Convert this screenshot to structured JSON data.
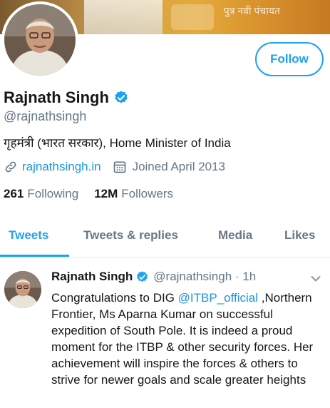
{
  "banner": {
    "text": "पुत्र नवी पंचायत"
  },
  "profile": {
    "name": "Rajnath Singh",
    "handle": "@rajnathsingh",
    "bio": "गृहमंत्री (भारत सरकार), Home Minister of India",
    "website": "rajnathsingh.in",
    "joined": "Joined April 2013",
    "following_count": "261",
    "following_label": "Following",
    "followers_count": "12M",
    "followers_label": "Followers"
  },
  "follow_button": {
    "label": "Follow"
  },
  "tabs": [
    {
      "label": "Tweets",
      "active": true
    },
    {
      "label": "Tweets & replies",
      "active": false
    },
    {
      "label": "Media",
      "active": false
    },
    {
      "label": "Likes",
      "active": false
    }
  ],
  "tweet": {
    "name": "Rajnath Singh",
    "handle_time": "@rajnathsingh · 1h",
    "text_before": "Congratulations to DIG ",
    "mention": "@ITBP_official",
    "text_after": " ,Northern Frontier, Ms Aparna Kumar on successful expedition of South Pole. It is indeed a proud moment for the ITBP & other security forces. Her achievement will inspire the forces & others to strive for newer goals and scale greater heights"
  },
  "colors": {
    "accent": "#1da1f2",
    "link": "#1b95e0",
    "muted": "#657786",
    "text": "#14171a"
  },
  "icons": [
    "verified-badge-icon",
    "link-icon",
    "calendar-icon",
    "chevron-down-icon"
  ]
}
